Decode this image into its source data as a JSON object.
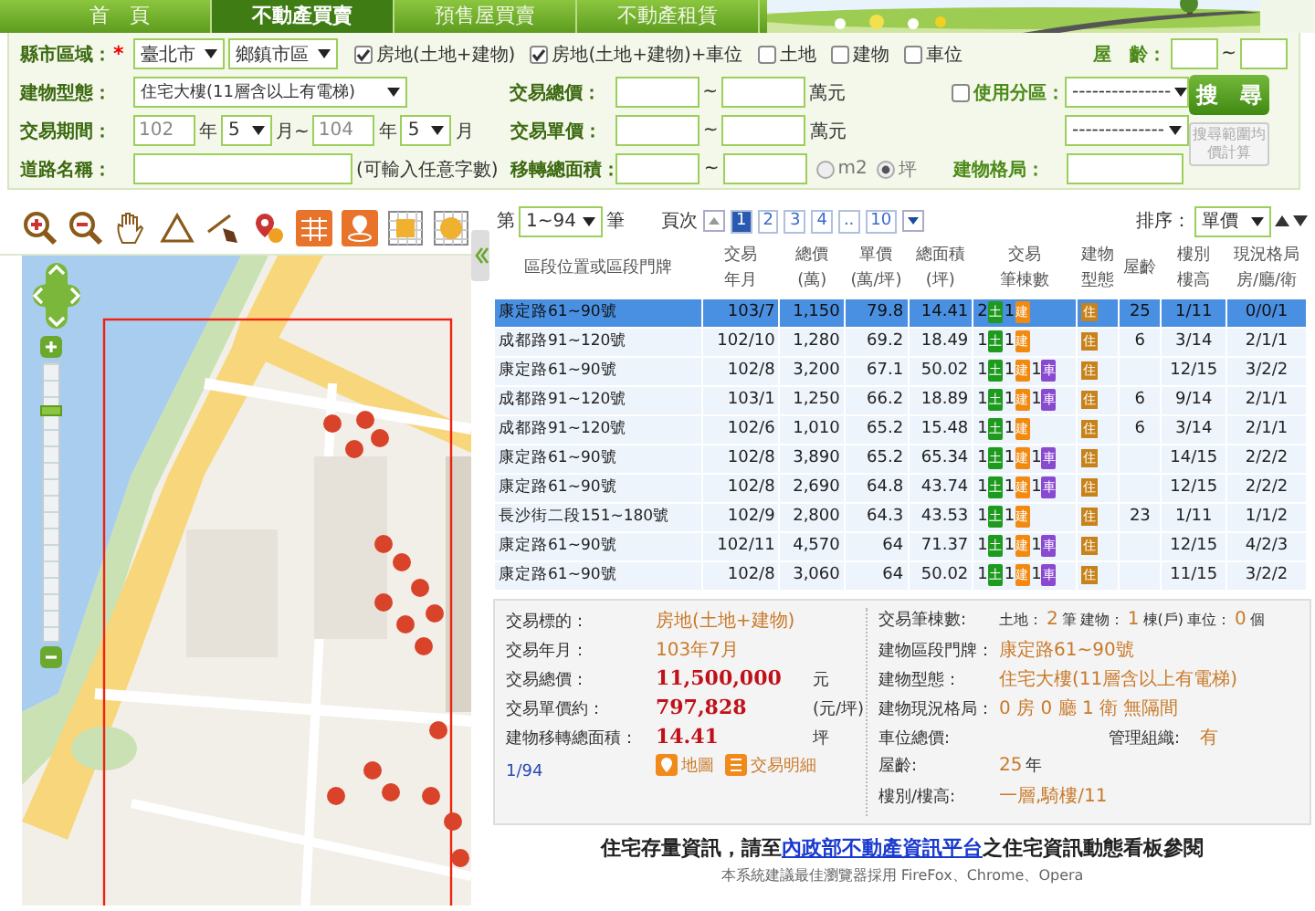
{
  "nav_tabs": [
    {
      "label": "首　頁",
      "selected": false
    },
    {
      "label": "不動產買賣",
      "selected": true
    },
    {
      "label": "預售屋買賣",
      "selected": false
    },
    {
      "label": "不動產租賃",
      "selected": false
    }
  ],
  "search_form": {
    "region": {
      "label": "縣市區域：",
      "required_mark": "*",
      "city": "臺北市",
      "district": "鄉鎮市區"
    },
    "targets": [
      {
        "label": "房地(土地+建物)",
        "checked": true
      },
      {
        "label": "房地(土地+建物)+車位",
        "checked": true
      },
      {
        "label": "土地",
        "checked": false
      },
      {
        "label": "建物",
        "checked": false
      },
      {
        "label": "車位",
        "checked": false
      }
    ],
    "age": {
      "label": "屋　齡：",
      "separator": "~"
    },
    "building_type": {
      "label": "建物型態：",
      "value": "住宅大樓(11層含以上有電梯)"
    },
    "period": {
      "label": "交易期間：",
      "from_year": "102",
      "year_unit": "年",
      "from_month": "5",
      "month_sep": "月~",
      "to_year": "104",
      "to_year_unit": "年",
      "to_month": "5",
      "month_unit": "月"
    },
    "road": {
      "label": "道路名稱：",
      "hint": "(可輸入任意字數)"
    },
    "total_price": {
      "label": "交易總價：",
      "separator": "~",
      "unit": "萬元"
    },
    "unit_price": {
      "label": "交易單價：",
      "separator": "~",
      "unit": "萬元"
    },
    "area": {
      "label": "移轉總面積：",
      "separator": "~",
      "units": [
        {
          "label": "m2",
          "selected": false
        },
        {
          "label": "坪",
          "selected": true
        }
      ]
    },
    "zoning": {
      "label": "使用分區：",
      "checked": false,
      "value": "---------------",
      "value_2": "--------------"
    },
    "layout": {
      "label": "建物格局："
    },
    "search_button": "搜　尋",
    "average_button": {
      "label": "搜尋範圍均價計算",
      "disabled": true
    }
  },
  "map": {
    "zoom_slider": {
      "level": 0.85
    }
  },
  "results": {
    "range_prefix": "第",
    "range": "1~94",
    "range_suffix": "筆",
    "page_label": "頁次",
    "pages": [
      {
        "label": "1",
        "selected": true
      },
      {
        "label": "2",
        "selected": false
      },
      {
        "label": "3",
        "selected": false
      },
      {
        "label": "4",
        "selected": false
      },
      {
        "label": "..",
        "selected": false
      },
      {
        "label": "10",
        "selected": false
      }
    ],
    "sort_label": "排序：",
    "sort_value": "單價",
    "columns": [
      [
        "區段位置或區段門牌"
      ],
      [
        "交易",
        "年月"
      ],
      [
        "總價",
        "(萬)"
      ],
      [
        "單價",
        "(萬/坪)"
      ],
      [
        "總面積",
        "(坪)"
      ],
      [
        "交易",
        "筆棟數"
      ],
      [
        "建物",
        "型態"
      ],
      [
        "屋齡"
      ],
      [
        "樓別",
        "樓高"
      ],
      [
        "現況格局",
        "房/廳/衛"
      ]
    ],
    "rows": [
      {
        "selected": true,
        "address": "康定路61~90號",
        "date": "103/7",
        "total": "1,150",
        "unit": "79.8",
        "area": "14.41",
        "counts": [
          {
            "kind": "land",
            "n": "2",
            "tag": "土"
          },
          {
            "kind": "building",
            "n": "1",
            "tag": "建"
          }
        ],
        "type": "住",
        "age": "25",
        "floor": "1/11",
        "layout": "0/0/1"
      },
      {
        "selected": false,
        "address": "成都路91~120號",
        "date": "102/10",
        "total": "1,280",
        "unit": "69.2",
        "area": "18.49",
        "counts": [
          {
            "kind": "land",
            "n": "1",
            "tag": "土"
          },
          {
            "kind": "building",
            "n": "1",
            "tag": "建"
          }
        ],
        "type": "住",
        "age": "6",
        "floor": "3/14",
        "layout": "2/1/1"
      },
      {
        "selected": false,
        "address": "康定路61~90號",
        "date": "102/8",
        "total": "3,200",
        "unit": "67.1",
        "area": "50.02",
        "counts": [
          {
            "kind": "land",
            "n": "1",
            "tag": "土"
          },
          {
            "kind": "building",
            "n": "1",
            "tag": "建"
          },
          {
            "kind": "parking",
            "n": "1",
            "tag": "車"
          }
        ],
        "type": "住",
        "floor": "12/15",
        "layout": "3/2/2"
      },
      {
        "selected": false,
        "address": "成都路91~120號",
        "date": "103/1",
        "total": "1,250",
        "unit": "66.2",
        "area": "18.89",
        "counts": [
          {
            "kind": "land",
            "n": "1",
            "tag": "土"
          },
          {
            "kind": "building",
            "n": "1",
            "tag": "建"
          },
          {
            "kind": "parking",
            "n": "1",
            "tag": "車"
          }
        ],
        "type": "住",
        "age": "6",
        "floor": "9/14",
        "layout": "2/1/1"
      },
      {
        "selected": false,
        "address": "成都路91~120號",
        "date": "102/6",
        "total": "1,010",
        "unit": "65.2",
        "area": "15.48",
        "counts": [
          {
            "kind": "land",
            "n": "1",
            "tag": "土"
          },
          {
            "kind": "building",
            "n": "1",
            "tag": "建"
          }
        ],
        "type": "住",
        "age": "6",
        "floor": "3/14",
        "layout": "2/1/1"
      },
      {
        "selected": false,
        "address": "康定路61~90號",
        "date": "102/8",
        "total": "3,890",
        "unit": "65.2",
        "area": "65.34",
        "counts": [
          {
            "kind": "land",
            "n": "1",
            "tag": "土"
          },
          {
            "kind": "building",
            "n": "1",
            "tag": "建"
          },
          {
            "kind": "parking",
            "n": "1",
            "tag": "車"
          }
        ],
        "type": "住",
        "floor": "14/15",
        "layout": "2/2/2"
      },
      {
        "selected": false,
        "address": "康定路61~90號",
        "date": "102/8",
        "total": "2,690",
        "unit": "64.8",
        "area": "43.74",
        "counts": [
          {
            "kind": "land",
            "n": "1",
            "tag": "土"
          },
          {
            "kind": "building",
            "n": "1",
            "tag": "建"
          },
          {
            "kind": "parking",
            "n": "1",
            "tag": "車"
          }
        ],
        "type": "住",
        "floor": "12/15",
        "layout": "2/2/2"
      },
      {
        "selected": false,
        "address": "長沙街二段151~180號",
        "date": "102/9",
        "total": "2,800",
        "unit": "64.3",
        "area": "43.53",
        "counts": [
          {
            "kind": "land",
            "n": "1",
            "tag": "土"
          },
          {
            "kind": "building",
            "n": "1",
            "tag": "建"
          }
        ],
        "type": "住",
        "age": "23",
        "floor": "1/11",
        "layout": "1/1/2"
      },
      {
        "selected": false,
        "address": "康定路61~90號",
        "date": "102/11",
        "total": "4,570",
        "unit": "64",
        "area": "71.37",
        "counts": [
          {
            "kind": "land",
            "n": "1",
            "tag": "土"
          },
          {
            "kind": "building",
            "n": "1",
            "tag": "建"
          },
          {
            "kind": "parking",
            "n": "1",
            "tag": "車"
          }
        ],
        "type": "住",
        "floor": "12/15",
        "layout": "4/2/3"
      },
      {
        "selected": false,
        "address": "康定路61~90號",
        "date": "102/8",
        "total": "3,060",
        "unit": "64",
        "area": "50.02",
        "counts": [
          {
            "kind": "land",
            "n": "1",
            "tag": "土"
          },
          {
            "kind": "building",
            "n": "1",
            "tag": "建"
          },
          {
            "kind": "parking",
            "n": "1",
            "tag": "車"
          }
        ],
        "type": "住",
        "floor": "11/15",
        "layout": "3/2/2"
      }
    ]
  },
  "detail": {
    "left": [
      {
        "label": "交易標的：",
        "value": "房地(土地+建物)",
        "kind": "plain"
      },
      {
        "label": "交易年月：",
        "value": "103年7月",
        "kind": "plain"
      },
      {
        "label": "交易總價：",
        "value": "11,500,000",
        "unit": "元",
        "kind": "money"
      },
      {
        "label": "交易單價約：",
        "value": "797,828",
        "unit": "(元/坪)",
        "kind": "money"
      },
      {
        "label": "建物移轉總面積：",
        "value": "14.41",
        "unit": "坪",
        "kind": "money"
      }
    ],
    "index": "1/94",
    "map_link": "地圖",
    "detail_link": "交易明細",
    "counts": {
      "label": "交易筆棟數:",
      "parts": [
        {
          "name": "土地：",
          "n": "2",
          "unit": "筆"
        },
        {
          "name": "建物：",
          "n": "1",
          "unit": "棟(戶)"
        },
        {
          "name": "車位：",
          "n": "0",
          "unit": "個"
        }
      ]
    },
    "right": [
      {
        "label": "建物區段門牌：",
        "value": "康定路61~90號"
      },
      {
        "label": "建物型態：",
        "value": "住宅大樓(11層含以上有電梯)"
      },
      {
        "label": "建物現況格局：",
        "value": "0 房 0 廳 1 衛 無隔間"
      }
    ],
    "parking_label": "車位總價:",
    "management_label": "管理組織:",
    "management_value": "有",
    "age_label": "屋齡:",
    "age_value": "25",
    "age_unit": "年",
    "floor_label": "樓別/樓高:",
    "floor_value": "一層,騎樓/11"
  },
  "footer": {
    "before": "住宅存量資訊，請至",
    "link": "內政部不動產資訊平台",
    "after": "之住宅資訊動態看板參閱",
    "note": "本系統建議最佳瀏覽器採用 FireFox、Chrome、Opera"
  }
}
